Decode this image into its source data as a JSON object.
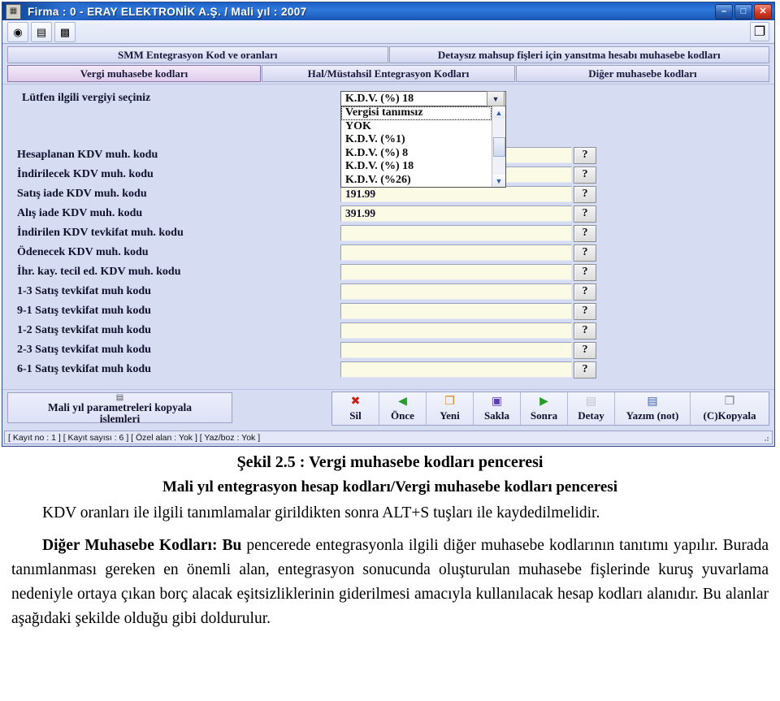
{
  "window": {
    "title": "Firma : 0 - ERAY ELEKTRONİK A.Ş.  / Mali yıl : 2007",
    "app_icon": "application-icon",
    "minimize": "–",
    "maximize": "□",
    "close": "✕"
  },
  "toolbar": {
    "buttons": [
      {
        "name": "help-icon",
        "glyph": "◉"
      },
      {
        "name": "calculator-icon",
        "glyph": "▤"
      },
      {
        "name": "payment-icon",
        "glyph": "▩"
      }
    ],
    "right_button": {
      "name": "window-list-icon",
      "glyph": "❐"
    }
  },
  "tabs": {
    "row1": [
      {
        "label": "SMM Entegrasyon Kod ve oranları",
        "selected": false
      },
      {
        "label": "Detaysız mahsup fişleri için yansıtma hesabı muhasebe kodları",
        "selected": false
      }
    ],
    "row2": [
      {
        "label": "Vergi muhasebe kodları",
        "selected": true
      },
      {
        "label": "Hal/Müstahsil Entegrasyon Kodları",
        "selected": false
      },
      {
        "label": "Diğer muhasebe kodları",
        "selected": false
      }
    ]
  },
  "form": {
    "intro_label": "Lütfen ilgili vergiyi seçiniz",
    "help_button_label": "?",
    "combo": {
      "selected": "K.D.V. (%) 18",
      "arrow": "▼",
      "options": [
        "Vergisi tanımsız",
        "YOK",
        "K.D.V. (%1)",
        "K.D.V. (%) 8",
        "K.D.V. (%) 18",
        "K.D.V. (%26)"
      ],
      "highlighted_index": 0,
      "scroll_up": "▲",
      "scroll_down": "▼"
    },
    "rows": [
      {
        "label": "Hesaplanan KDV muh. kodu",
        "value": "",
        "hidden_by_list": true
      },
      {
        "label": "İndirilecek KDV muh. kodu",
        "value": "",
        "hidden_by_list": true
      },
      {
        "label": "Satış iade KDV muh. kodu",
        "value": "191.99",
        "hidden_by_list": false
      },
      {
        "label": "Alış iade KDV muh. kodu",
        "value": "391.99",
        "hidden_by_list": false
      },
      {
        "label": "İndirilen KDV tevkifat muh. kodu",
        "value": "",
        "hidden_by_list": false
      },
      {
        "label": "Ödenecek KDV muh. kodu",
        "value": "",
        "hidden_by_list": false
      },
      {
        "label": "İhr. kay. tecil ed. KDV muh. kodu",
        "value": "",
        "hidden_by_list": false
      },
      {
        "label": "1-3 Satış tevkifat muh kodu",
        "value": "",
        "hidden_by_list": false
      },
      {
        "label": "9-1 Satış tevkifat muh kodu",
        "value": "",
        "hidden_by_list": false
      },
      {
        "label": "1-2 Satış tevkifat muh kodu",
        "value": "",
        "hidden_by_list": false
      },
      {
        "label": "2-3 Satış tevkifat muh kodu",
        "value": "",
        "hidden_by_list": false
      },
      {
        "label": "6-1 Satış tevkifat muh kodu",
        "value": "",
        "hidden_by_list": false
      }
    ]
  },
  "bottom": {
    "copy_button_line1": "Mali yıl parametreleri kopyala",
    "copy_button_line2": "işlemleri",
    "copy_button_icon": "copy-parameters-icon",
    "actions": [
      {
        "label": "Sil",
        "icon": "delete-icon",
        "glyph": "✖",
        "color": "#c81e0f",
        "disabled": false
      },
      {
        "label": "Önce",
        "icon": "previous-icon",
        "glyph": "◀",
        "color": "#2a9b2a",
        "disabled": false
      },
      {
        "label": "Yeni",
        "icon": "new-icon",
        "glyph": "❒",
        "color": "#d08a22",
        "disabled": false
      },
      {
        "label": "Sakla",
        "icon": "save-icon",
        "glyph": "▣",
        "color": "#5a3fb0",
        "disabled": false
      },
      {
        "label": "Sonra",
        "icon": "next-icon",
        "glyph": "▶",
        "color": "#2a9b2a",
        "disabled": false
      },
      {
        "label": "Detay",
        "icon": "detail-icon",
        "glyph": "▤",
        "color": "#8a8a8a",
        "disabled": true
      },
      {
        "label": "Yazım (not)",
        "icon": "note-icon",
        "glyph": "▤",
        "color": "#3a5fa8",
        "disabled": false
      },
      {
        "label": "(C)Kopyala",
        "icon": "copy-icon",
        "glyph": "❐",
        "color": "#7a7a8a",
        "disabled": false
      }
    ]
  },
  "statusbar": {
    "text": "[ Kayıt no : 1 ] [ Kayıt sayısı : 6 ] [ Özel alan : Yok ] [ Yaz/boz : Yok ]"
  },
  "caption": {
    "figure_title": "Şekil 2.5 :  Vergi muhasebe kodları penceresi",
    "subtitle": "Mali yıl entegrasyon hesap kodları/Vergi muhasebe kodları penceresi",
    "paragraph1": "KDV oranları ile ilgili tanımlamalar girildikten sonra ALT+S tuşları ile kaydedilmelidir.",
    "paragraph2_lead": "Diğer Muhasebe Kodları: Bu",
    "paragraph2_rest": " pencerede entegrasyonla ilgili diğer muhasebe kodlarının tanıtımı yapılır. Burada tanımlanması gereken en önemli alan, entegrasyon sonucunda oluşturulan muhasebe fişlerinde kuruş yuvarlama nedeniyle ortaya çıkan borç alacak eşitsizliklerinin giderilmesi amacıyla kullanılacak hesap kodları alanıdır. Bu alanlar aşağıdaki şekilde olduğu gibi doldurulur."
  },
  "colors": {
    "window_bg": "#d6dcf2",
    "title_blue": "#1c5fc4",
    "field_cream": "#fbfae4",
    "tab_selected": "#e8d9f2"
  }
}
